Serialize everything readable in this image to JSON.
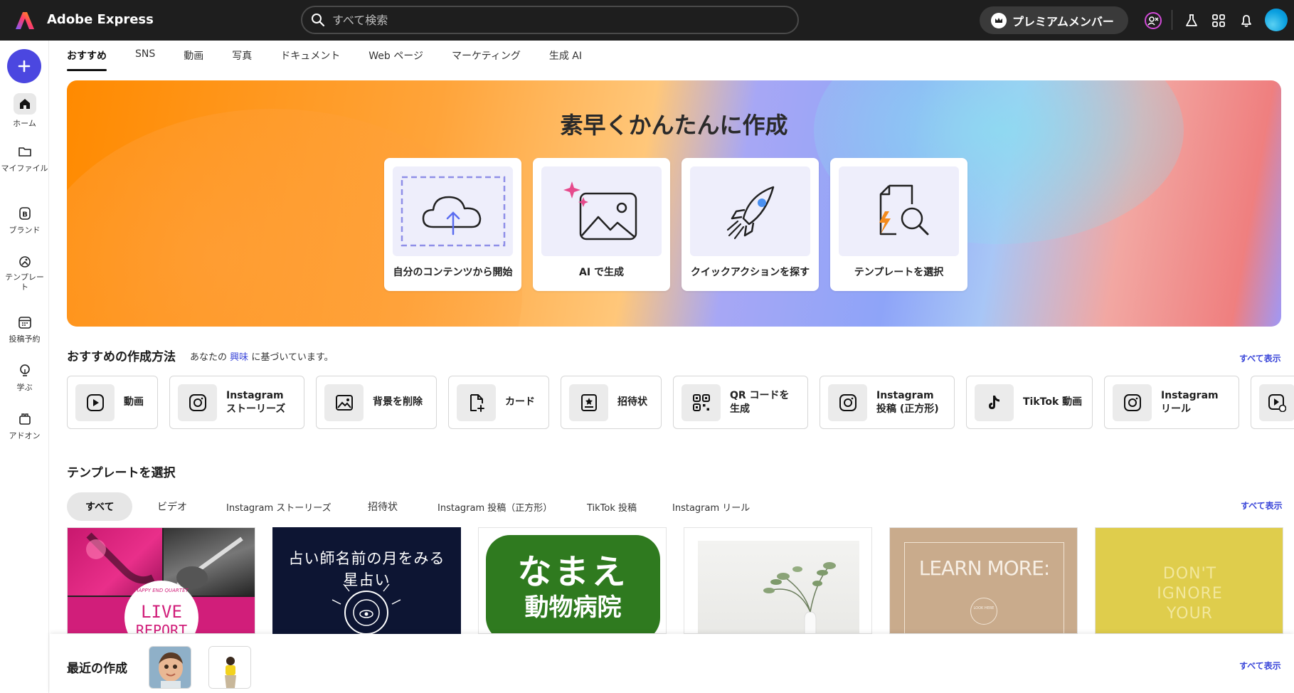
{
  "app": {
    "title": "Adobe Express"
  },
  "search": {
    "placeholder": "すべて検索"
  },
  "header": {
    "premium_label": "プレミアムメンバー"
  },
  "sidebar": {
    "items": [
      {
        "label": "ホーム"
      },
      {
        "label": "マイファイル"
      },
      {
        "label": "ブランド"
      },
      {
        "label": "テンプレート"
      },
      {
        "label": "投稿予約"
      },
      {
        "label": "学ぶ"
      },
      {
        "label": "アドオン"
      }
    ]
  },
  "tabs": [
    "おすすめ",
    "SNS",
    "動画",
    "写真",
    "ドキュメント",
    "Web ページ",
    "マーケティング",
    "生成 AI"
  ],
  "hero": {
    "title": "素早くかんたんに作成",
    "cards": [
      {
        "label": "自分のコンテンツから開始"
      },
      {
        "label": "AI で生成"
      },
      {
        "label": "クイックアクションを探す"
      },
      {
        "label": "テンプレートを選択"
      }
    ]
  },
  "recommended": {
    "title": "おすすめの作成方法",
    "subtitle_prefix": "あなたの",
    "subtitle_link": "興味",
    "subtitle_suffix": "に基づいています。",
    "see_all": "すべて表示",
    "actions": [
      {
        "label": "動画",
        "icon": "play-icon"
      },
      {
        "label": "Instagram\nストーリーズ",
        "icon": "instagram-icon"
      },
      {
        "label": "背景を削除",
        "icon": "remove-background-icon"
      },
      {
        "label": "カード",
        "icon": "card-icon"
      },
      {
        "label": "招待状",
        "icon": "invitation-icon"
      },
      {
        "label": "QR コードを\n生成",
        "icon": "qr-code-icon"
      },
      {
        "label": "Instagram\n投稿 (正方形)",
        "icon": "instagram-icon"
      },
      {
        "label": "TikTok 動画",
        "icon": "tiktok-icon"
      },
      {
        "label": "Instagram\nリール",
        "icon": "instagram-icon"
      }
    ]
  },
  "templates": {
    "title": "テンプレートを選択",
    "see_all": "すべて表示",
    "filters": [
      "すべて",
      "ビデオ",
      "Instagram ストーリーズ",
      "招待状",
      "Instagram 投稿（正方形）",
      "TikTok 投稿",
      "Instagram リール"
    ],
    "items": [
      {
        "text_line1": "HAPPY END QUARTET",
        "text_line2": "LIVE",
        "text_line3": "REPORT"
      },
      {
        "text": "占い師名前の月をみる星占い"
      },
      {
        "text_line1": "なまえ",
        "text_line2": "動物病院"
      },
      {
        "text": ""
      },
      {
        "text": "LEARN MORE:",
        "badge": "LOOK HERE"
      },
      {
        "text_line1": "DON'T",
        "text_line2": "IGNORE",
        "text_line3": "YOUR"
      }
    ]
  },
  "recent": {
    "title": "最近の作成",
    "see_all": "すべて表示"
  },
  "colors": {
    "accent": "#4b47e0",
    "link": "#3a46d9",
    "topbar": "#1e1e1e"
  }
}
